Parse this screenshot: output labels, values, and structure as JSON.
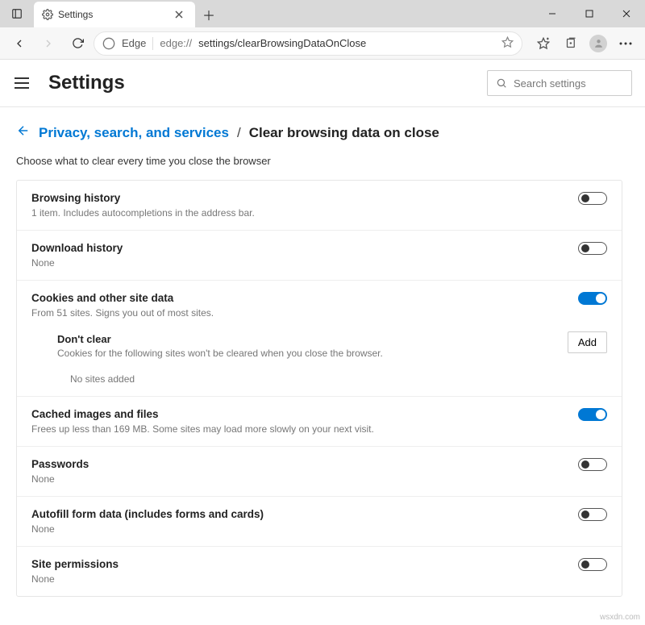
{
  "window": {
    "tab_title": "Settings",
    "edge_label": "Edge",
    "url_protocol": "edge://",
    "url_path": "settings/clearBrowsingDataOnClose"
  },
  "header": {
    "title": "Settings",
    "search_placeholder": "Search settings"
  },
  "breadcrumb": {
    "parent": "Privacy, search, and services",
    "separator": "/",
    "current": "Clear browsing data on close"
  },
  "subtext": "Choose what to clear every time you close the browser",
  "rows": {
    "browsing_history": {
      "title": "Browsing history",
      "desc": "1 item. Includes autocompletions in the address bar.",
      "on": false
    },
    "download_history": {
      "title": "Download history",
      "desc": "None",
      "on": false
    },
    "cookies": {
      "title": "Cookies and other site data",
      "desc": "From 51 sites. Signs you out of most sites.",
      "on": true
    },
    "dont_clear": {
      "title": "Don't clear",
      "desc": "Cookies for the following sites won't be cleared when you close the browser.",
      "add_label": "Add",
      "empty": "No sites added"
    },
    "cached": {
      "title": "Cached images and files",
      "desc": "Frees up less than 169 MB. Some sites may load more slowly on your next visit.",
      "on": true
    },
    "passwords": {
      "title": "Passwords",
      "desc": "None",
      "on": false
    },
    "autofill": {
      "title": "Autofill form data (includes forms and cards)",
      "desc": "None",
      "on": false
    },
    "site_permissions": {
      "title": "Site permissions",
      "desc": "None",
      "on": false
    }
  },
  "watermark": "wsxdn.com"
}
